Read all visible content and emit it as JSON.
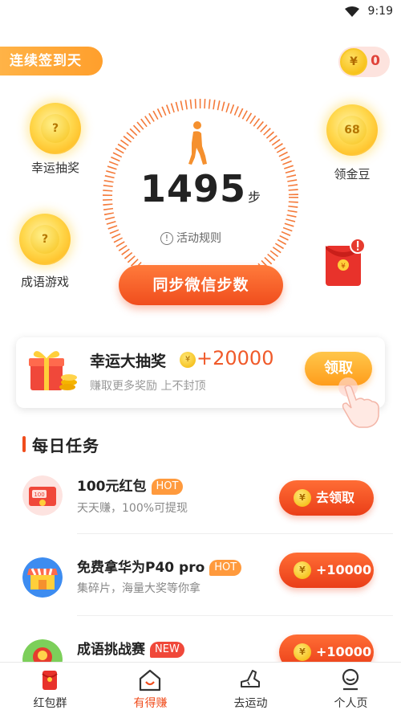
{
  "status_bar": {
    "time": "9:19"
  },
  "header": {
    "signin_label": "连续签到天",
    "coin_symbol": "¥",
    "coin_balance": "0"
  },
  "bubbles": [
    {
      "value": "?",
      "label": "幸运抽奖"
    },
    {
      "value": "?",
      "label": "成语游戏"
    },
    {
      "value": "68",
      "label": "领金豆"
    }
  ],
  "steps": {
    "count": "1495",
    "unit": "步",
    "rules_label": "活动规则",
    "sync_button": "同步微信步数"
  },
  "lottery": {
    "title": "幸运大抽奖",
    "amount": "+20000",
    "subtitle": "赚取更多奖励 上不封顶",
    "button": "领取",
    "coin_symbol": "¥"
  },
  "daily": {
    "title": "每日任务",
    "tasks": [
      {
        "title": "100元红包",
        "badge": "HOT",
        "subtitle": "天天赚，100%可提现",
        "button": "去领取",
        "icon": "red-envelope-100-icon"
      },
      {
        "title": "免费拿华为P40 pro",
        "badge": "HOT",
        "subtitle": "集碎片，海量大奖等你拿",
        "button": "+10000",
        "icon": "shop-icon"
      },
      {
        "title": "成语挑战赛",
        "badge": "NEW",
        "subtitle": "",
        "button": "+10000",
        "icon": "idiom-game-icon"
      }
    ]
  },
  "tabbar": {
    "items": [
      {
        "label": "红包群",
        "icon": "red-packet-icon"
      },
      {
        "label": "有得赚",
        "icon": "home-icon"
      },
      {
        "label": "去运动",
        "icon": "sneaker-icon"
      },
      {
        "label": "个人页",
        "icon": "profile-icon"
      }
    ],
    "active_index": 1
  },
  "colors": {
    "accent": "#f04d1d",
    "gold": "#ffb347"
  }
}
